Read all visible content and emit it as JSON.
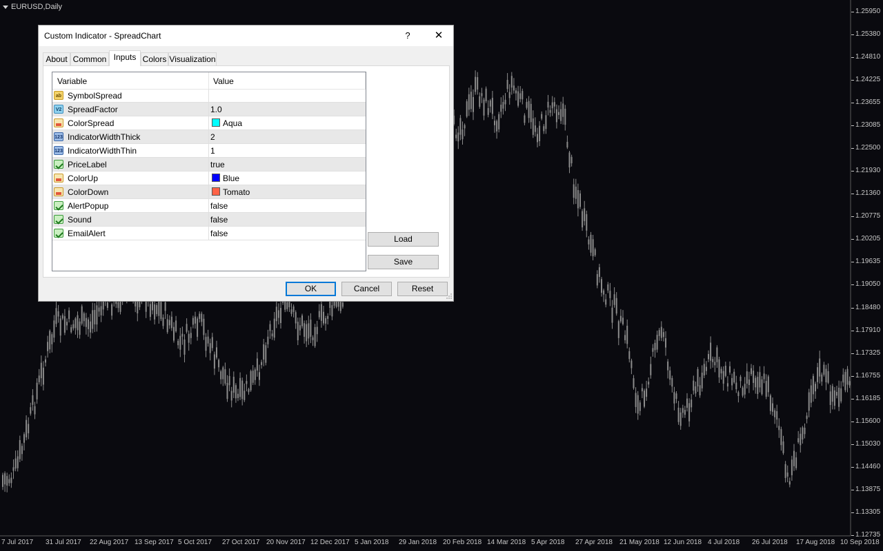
{
  "chart": {
    "title": "EURUSD,Daily",
    "price_labels": [
      "1.25950",
      "1.25380",
      "1.24810",
      "1.24225",
      "1.23655",
      "1.23085",
      "1.22500",
      "1.21930",
      "1.21360",
      "1.20775",
      "1.20205",
      "1.19635",
      "1.19050",
      "1.18480",
      "1.17910",
      "1.17325",
      "1.16755",
      "1.16185",
      "1.15600",
      "1.15030",
      "1.14460",
      "1.13875",
      "1.13305",
      "1.12735"
    ],
    "date_labels": [
      "7 Jul 2017",
      "31 Jul 2017",
      "22 Aug 2017",
      "13 Sep 2017",
      "5 Oct 2017",
      "27 Oct 2017",
      "20 Nov 2017",
      "12 Dec 2017",
      "5 Jan 2018",
      "29 Jan 2018",
      "20 Feb 2018",
      "14 Mar 2018",
      "5 Apr 2018",
      "27 Apr 2018",
      "21 May 2018",
      "12 Jun 2018",
      "4 Jul 2018",
      "26 Jul 2018",
      "17 Aug 2018",
      "10 Sep 2018"
    ],
    "colors": {
      "background": "#0a0a0f",
      "candle": "#8c8c8c",
      "axis_text": "#c8c8c8"
    }
  },
  "dialog": {
    "title": "Custom Indicator - SpreadChart",
    "help_label": "?",
    "close_label": "✕",
    "tabs": [
      {
        "label": "About"
      },
      {
        "label": "Common"
      },
      {
        "label": "Inputs",
        "active": true
      },
      {
        "label": "Colors"
      },
      {
        "label": "Visualization"
      }
    ],
    "grid": {
      "headers": {
        "variable": "Variable",
        "value": "Value"
      },
      "rows": [
        {
          "icon": "string-icon",
          "variable": "SymbolSpread",
          "value": ""
        },
        {
          "icon": "double-icon",
          "variable": "SpreadFactor",
          "value": "1.0"
        },
        {
          "icon": "color-icon",
          "variable": "ColorSpread",
          "value": "Aqua",
          "swatch": "#00ffff"
        },
        {
          "icon": "integer-icon",
          "variable": "IndicatorWidthThick",
          "value": "2"
        },
        {
          "icon": "integer-icon",
          "variable": "IndicatorWidthThin",
          "value": "1"
        },
        {
          "icon": "bool-icon",
          "variable": "PriceLabel",
          "value": "true"
        },
        {
          "icon": "color-icon",
          "variable": "ColorUp",
          "value": "Blue",
          "swatch": "#0000ff"
        },
        {
          "icon": "color-icon",
          "variable": "ColorDown",
          "value": "Tomato",
          "swatch": "#ff6347"
        },
        {
          "icon": "bool-icon",
          "variable": "AlertPopup",
          "value": "false"
        },
        {
          "icon": "bool-icon",
          "variable": "Sound",
          "value": "false"
        },
        {
          "icon": "bool-icon",
          "variable": "EmailAlert",
          "value": "false"
        }
      ]
    },
    "buttons": {
      "load": "Load",
      "save": "Save",
      "ok": "OK",
      "cancel": "Cancel",
      "reset": "Reset"
    }
  }
}
